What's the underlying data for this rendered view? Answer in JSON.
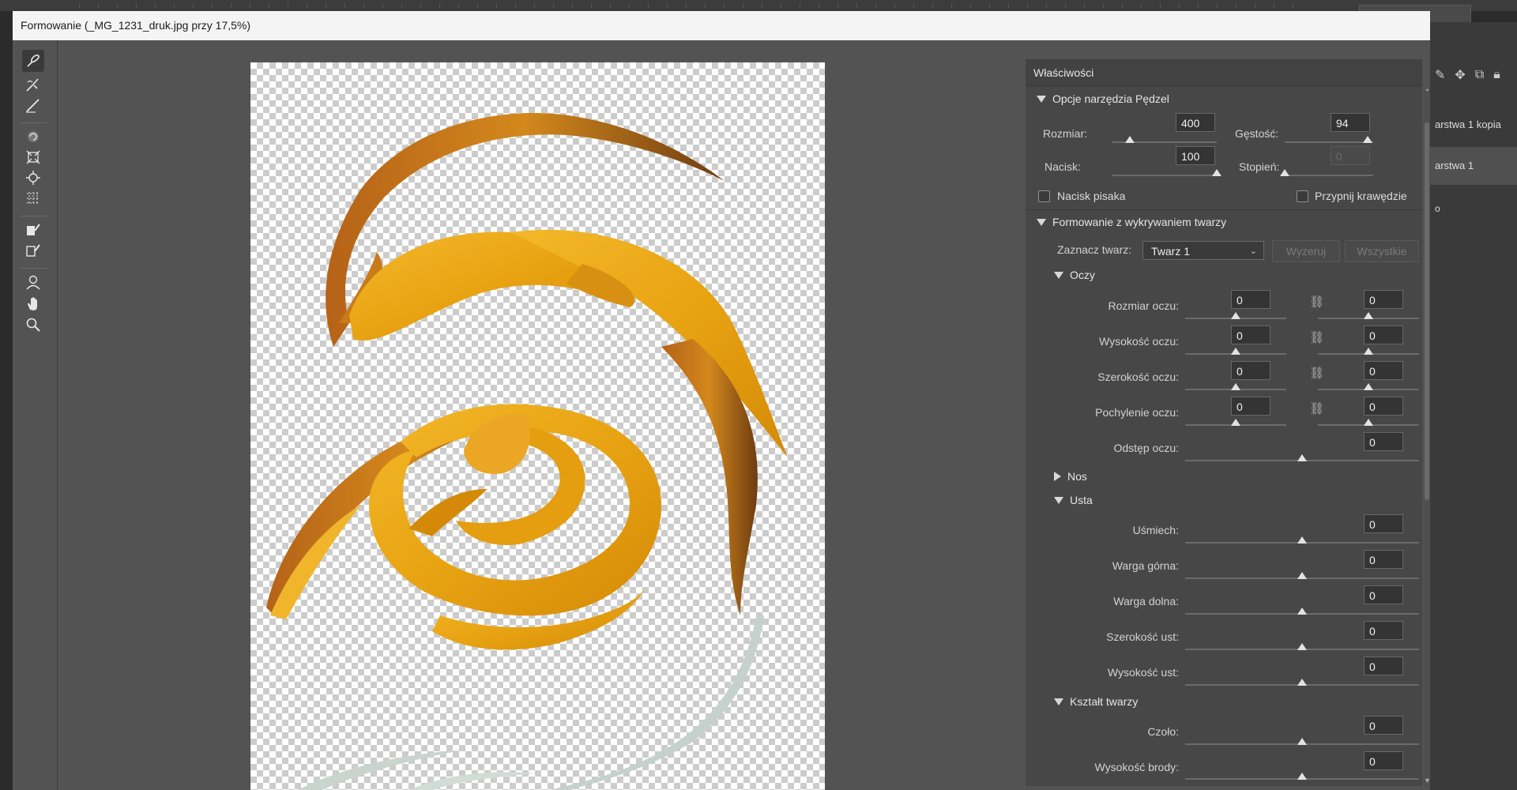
{
  "app": {
    "right_panel_layers": [
      "arstwa 1 kopia",
      "arstwa 1",
      "o"
    ]
  },
  "dialog": {
    "title": "Formowanie (_MG_1231_druk.jpg przy 17,5%)"
  },
  "tools": [
    {
      "name": "forward-warp-tool-icon",
      "active": true
    },
    {
      "name": "reconstruct-tool-icon"
    },
    {
      "name": "smooth-tool-icon"
    },
    {
      "name": "twirl-tool-icon"
    },
    {
      "name": "pucker-tool-icon"
    },
    {
      "name": "bloat-tool-icon"
    },
    {
      "name": "push-left-tool-icon"
    },
    {
      "name": "freeze-mask-tool-icon"
    },
    {
      "name": "thaw-mask-tool-icon"
    },
    {
      "name": "face-tool-icon"
    },
    {
      "name": "hand-tool-icon"
    },
    {
      "name": "zoom-tool-icon"
    }
  ],
  "properties": {
    "title": "Właściwości",
    "brush": {
      "section_label": "Opcje narzędzia Pędzel",
      "size_label": "Rozmiar:",
      "size_value": "400",
      "size_level": 0.17,
      "density_label": "Gęstość:",
      "density_value": "94",
      "density_level": 0.94,
      "pressure_label": "Nacisk:",
      "pressure_value": "100",
      "pressure_level": 1.0,
      "rate_label": "Stopień:",
      "rate_value": "0",
      "rate_level": 0.0,
      "stylus_label": "Nacisk pisaka",
      "pin_edges_label": "Przypnij krawędzie"
    },
    "face": {
      "section_label": "Formowanie z wykrywaniem twarzy",
      "select_label": "Zaznacz twarz:",
      "select_value": "Twarz 1",
      "reset_label": "Wyzeruj",
      "all_label": "Wszystkie",
      "eyes": {
        "section_label": "Oczy",
        "size_label": "Rozmiar oczu:",
        "size_left": "0",
        "size_right": "0",
        "height_label": "Wysokość oczu:",
        "height_left": "0",
        "height_right": "0",
        "width_label": "Szerokość oczu:",
        "width_left": "0",
        "width_right": "0",
        "tilt_label": "Pochylenie oczu:",
        "tilt_left": "0",
        "tilt_right": "0",
        "distance_label": "Odstęp oczu:",
        "distance_value": "0"
      },
      "nose": {
        "section_label": "Nos"
      },
      "mouth": {
        "section_label": "Usta",
        "smile_label": "Uśmiech:",
        "smile_value": "0",
        "upper_lip_label": "Warga górna:",
        "upper_lip_value": "0",
        "lower_lip_label": "Warga dolna:",
        "lower_lip_value": "0",
        "width_label": "Szerokość ust:",
        "width_value": "0",
        "height_label": "Wysokość ust:",
        "height_value": "0"
      },
      "shape": {
        "section_label": "Kształt twarzy",
        "forehead_label": "Czoło:",
        "forehead_value": "0",
        "chin_height_label": "Wysokość brody:",
        "chin_height_value": "0"
      }
    }
  },
  "colors": {
    "panel_bg": "#474747",
    "dialog_bg": "#535353",
    "liquid_gold": "#e9a114",
    "liquid_dark": "#8a4a12",
    "liquid_pale": "#c8d4cf"
  }
}
